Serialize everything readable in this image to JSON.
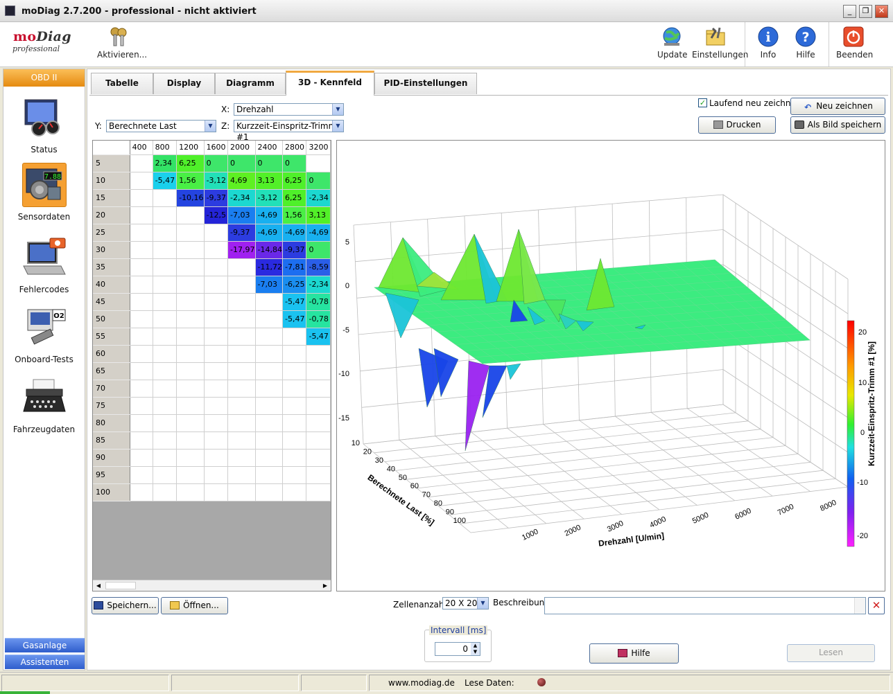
{
  "window": {
    "title": "moDiag 2.7.200 - professional - nicht aktiviert"
  },
  "logo": {
    "brand_a": "mo",
    "brand_b": "Diag",
    "subtitle": "professional"
  },
  "toolbar": {
    "activate": "Aktivieren...",
    "update": "Update",
    "settings": "Einstellungen",
    "info": "Info",
    "help": "Hilfe",
    "quit": "Beenden"
  },
  "sidebar": {
    "header": "OBD II",
    "items": [
      {
        "label": "Status"
      },
      {
        "label": "Sensordaten"
      },
      {
        "label": "Fehlercodes"
      },
      {
        "label": "Onboard-Tests"
      },
      {
        "label": "Fahrzeugdaten"
      }
    ],
    "bottom": [
      "Gasanlage",
      "Assistenten"
    ]
  },
  "tabs": [
    "Tabelle",
    "Display",
    "Diagramm",
    "3D - Kennfeld",
    "PID-Einstellungen"
  ],
  "controls": {
    "x_label": "X:",
    "x_value": "Drehzahl",
    "y_label": "Y:",
    "y_value": "Berechnete Last",
    "z_label": "Z:",
    "z_value": "Kurzzeit-Einspritz-Trimm #1",
    "redraw_check": "Laufend neu zeichnen",
    "redraw_btn": "Neu zeichnen",
    "print_btn": "Drucken",
    "save_image_btn": "Als Bild speichern"
  },
  "table": {
    "columns": [
      "400",
      "800",
      "1200",
      "1600",
      "2000",
      "2400",
      "2800",
      "3200"
    ],
    "rows": [
      "5",
      "10",
      "15",
      "20",
      "25",
      "30",
      "35",
      "40",
      "45",
      "50",
      "55",
      "60",
      "65",
      "70",
      "75",
      "80",
      "85",
      "90",
      "95",
      "100"
    ],
    "cells": [
      [
        "",
        "2,34",
        "6,25",
        "0",
        "0",
        "0",
        "0",
        ""
      ],
      [
        "",
        "-5,47",
        "1,56",
        "-3,12",
        "4,69",
        "3,13",
        "6,25",
        "0"
      ],
      [
        "",
        "",
        "-10,16",
        "-9,37",
        "-2,34",
        "-3,12",
        "6,25",
        "-2,34"
      ],
      [
        "",
        "",
        "",
        "-12,5",
        "-7,03",
        "-4,69",
        "1,56",
        "3,13"
      ],
      [
        "",
        "",
        "",
        "",
        "-9,37",
        "-4,69",
        "-4,69",
        "-4,69"
      ],
      [
        "",
        "",
        "",
        "",
        "-17,97",
        "-14,84",
        "-9,37",
        "0"
      ],
      [
        "",
        "",
        "",
        "",
        "",
        "-11,72",
        "-7,81",
        "-8,59"
      ],
      [
        "",
        "",
        "",
        "",
        "",
        "-7,03",
        "-6,25",
        "-2,34"
      ],
      [
        "",
        "",
        "",
        "",
        "",
        "",
        "-5,47",
        "-0,78"
      ],
      [
        "",
        "",
        "",
        "",
        "",
        "",
        "-5,47",
        "-0,78"
      ],
      [
        "",
        "",
        "",
        "",
        "",
        "",
        "",
        "-5,47"
      ],
      [
        "",
        "",
        "",
        "",
        "",
        "",
        "",
        ""
      ],
      [
        "",
        "",
        "",
        "",
        "",
        "",
        "",
        ""
      ],
      [
        "",
        "",
        "",
        "",
        "",
        "",
        "",
        ""
      ],
      [
        "",
        "",
        "",
        "",
        "",
        "",
        "",
        ""
      ],
      [
        "",
        "",
        "",
        "",
        "",
        "",
        "",
        ""
      ],
      [
        "",
        "",
        "",
        "",
        "",
        "",
        "",
        ""
      ],
      [
        "",
        "",
        "",
        "",
        "",
        "",
        "",
        ""
      ],
      [
        "",
        "",
        "",
        "",
        "",
        "",
        "",
        ""
      ],
      [
        "",
        "",
        "",
        "",
        "",
        "",
        "",
        ""
      ]
    ],
    "colors": [
      [
        "",
        "#33e266",
        "#4ff02a",
        "#3ee66a",
        "#3ee66a",
        "#3ee66a",
        "#3ee66a",
        ""
      ],
      [
        "",
        "#1ad0ec",
        "#49ef45",
        "#22e0b8",
        "#5ef022",
        "#52f028",
        "#4ff02a",
        "#3ee66a"
      ],
      [
        "",
        "",
        "#2444e0",
        "#2c3ce0",
        "#1cd8d0",
        "#22e0b8",
        "#4ff02a",
        "#1cd8d0"
      ],
      [
        "",
        "",
        "",
        "#2424d8",
        "#1a7ef0",
        "#18b0f0",
        "#49ef45",
        "#52f028"
      ],
      [
        "",
        "",
        "",
        "",
        "#2c3ce0",
        "#18b0f0",
        "#18b0f0",
        "#18b0f0"
      ],
      [
        "",
        "",
        "",
        "",
        "#a020f0",
        "#6a28e8",
        "#2c3ce0",
        "#3ee66a"
      ],
      [
        "",
        "",
        "",
        "",
        "",
        "#2a2ae0",
        "#1c6ef0",
        "#2a5ee8"
      ],
      [
        "",
        "",
        "",
        "",
        "",
        "#1a7ef0",
        "#1a8ef0",
        "#1cd8d0"
      ],
      [
        "",
        "",
        "",
        "",
        "",
        "",
        "#1ac2f0",
        "#26e4a0"
      ],
      [
        "",
        "",
        "",
        "",
        "",
        "",
        "#1ac2f0",
        "#26e4a0"
      ],
      [
        "",
        "",
        "",
        "",
        "",
        "",
        "",
        "#1ac2f0"
      ]
    ]
  },
  "chart": {
    "z_ticks": [
      "5",
      "0",
      "-5",
      "-10",
      "-15"
    ],
    "y_ticks": [
      "10",
      "20",
      "30",
      "40",
      "50",
      "60",
      "70",
      "80",
      "90",
      "100"
    ],
    "x_ticks": [
      "1000",
      "2000",
      "3000",
      "4000",
      "5000",
      "6000",
      "7000",
      "8000"
    ],
    "x_label": "Drehzahl [U/min]",
    "y_label": "Berechnete Last [%]",
    "colorbar_label": "Kurzzeit-Einspritz-Trimm #1 [%]",
    "colorbar_ticks": [
      "20",
      "10",
      "0",
      "-10",
      "-20"
    ],
    "colors": {
      "surface": "#3cec80",
      "spike_green": "#6ee830",
      "spike_blue": "#1844e8",
      "spike_violet": "#9a22f0",
      "spike_cyan": "#1ac4d8"
    }
  },
  "bottom": {
    "save": "Speichern...",
    "open": "Öffnen...",
    "cell_count_label": "Zellenanzahl:",
    "cell_count_value": "20 X 20",
    "desc_label": "Beschreibung",
    "interval_label": "Intervall [ms]",
    "interval_value": "0",
    "help_btn": "Hilfe",
    "read_btn": "Lesen"
  },
  "status": {
    "url": "www.modiag.de",
    "reading": "Lese Daten:"
  }
}
